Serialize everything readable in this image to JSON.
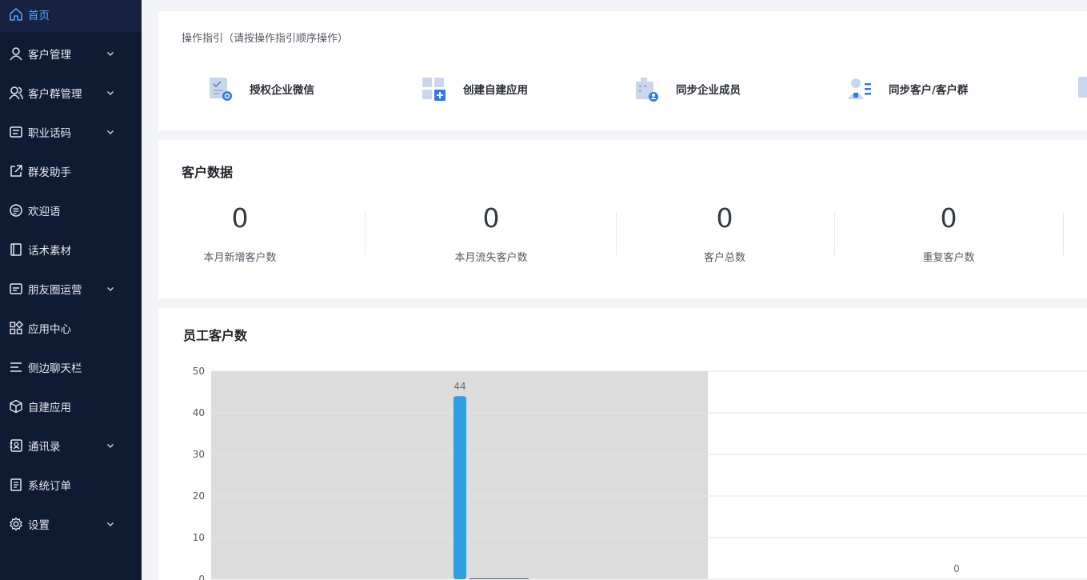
{
  "sidebar": {
    "items": [
      {
        "label": "首页",
        "icon": "home-icon",
        "active": true,
        "expandable": false
      },
      {
        "label": "客户管理",
        "icon": "user-icon",
        "active": false,
        "expandable": true
      },
      {
        "label": "客户群管理",
        "icon": "group-icon",
        "active": false,
        "expandable": true
      },
      {
        "label": "职业话码",
        "icon": "script-icon",
        "active": false,
        "expandable": true
      },
      {
        "label": "群发助手",
        "icon": "share-icon",
        "active": false,
        "expandable": false
      },
      {
        "label": "欢迎语",
        "icon": "message-icon",
        "active": false,
        "expandable": false
      },
      {
        "label": "话术素材",
        "icon": "book-icon",
        "active": false,
        "expandable": false
      },
      {
        "label": "朋友圈运营",
        "icon": "moments-icon",
        "active": false,
        "expandable": true
      },
      {
        "label": "应用中心",
        "icon": "apps-icon",
        "active": false,
        "expandable": false
      },
      {
        "label": "侧边聊天栏",
        "icon": "menu-lines-icon",
        "active": false,
        "expandable": false
      },
      {
        "label": "自建应用",
        "icon": "cube-icon",
        "active": false,
        "expandable": false
      },
      {
        "label": "通讯录",
        "icon": "contacts-icon",
        "active": false,
        "expandable": true
      },
      {
        "label": "系统订单",
        "icon": "order-icon",
        "active": false,
        "expandable": false
      },
      {
        "label": "设置",
        "icon": "gear-icon",
        "active": false,
        "expandable": true
      }
    ]
  },
  "guide": {
    "title": "操作指引（请按操作指引顺序操作）",
    "steps": [
      {
        "label": "授权企业微信",
        "icon": "authorize-icon"
      },
      {
        "label": "创建自建应用",
        "icon": "create-app-icon"
      },
      {
        "label": "同步企业成员",
        "icon": "sync-members-icon"
      },
      {
        "label": "同步客户/客户群",
        "icon": "sync-customers-icon"
      }
    ]
  },
  "customer_data": {
    "title": "客户数据",
    "stats": [
      {
        "value": "0",
        "label": "本月新增客户数"
      },
      {
        "value": "0",
        "label": "本月流失客户数"
      },
      {
        "value": "0",
        "label": "客户总数"
      },
      {
        "value": "0",
        "label": "重复客户数"
      }
    ]
  },
  "employee_chart": {
    "title": "员工客户数"
  },
  "colors": {
    "sidebar_bg": "#0f1a33",
    "active": "#5aa2ff",
    "bar": "#2e9fe0"
  },
  "chart_data": {
    "type": "bar",
    "title": "员工客户数",
    "ylim": [
      0,
      50
    ],
    "yticks": [
      0,
      10,
      20,
      30,
      40,
      50
    ],
    "grid": true,
    "series": [
      {
        "values": [
          44,
          0
        ]
      }
    ],
    "data_labels": [
      "44",
      "0"
    ]
  }
}
